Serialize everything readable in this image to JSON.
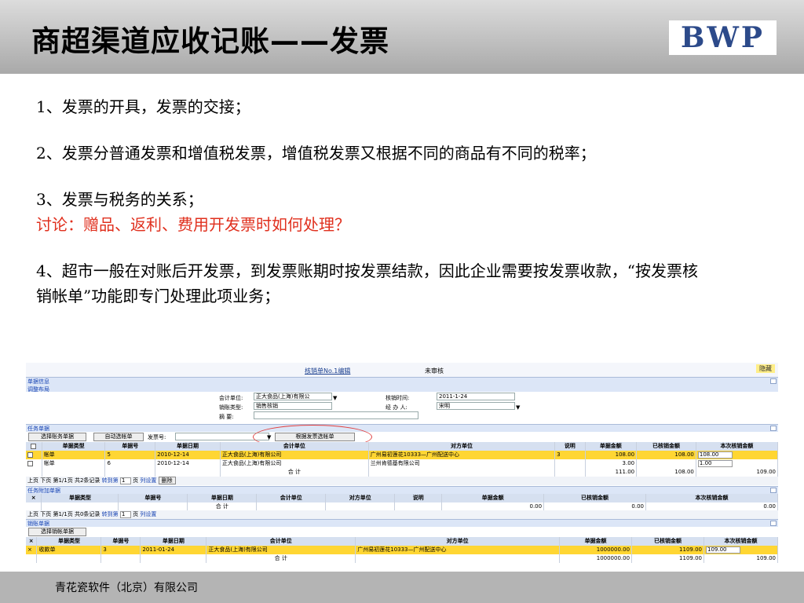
{
  "slide": {
    "title": "商超渠道应收记账——发票",
    "logo": "BWP",
    "points": [
      "1、发票的开具，发票的交接；",
      "2、发票分普通发票和增值税发票，增值税发票又根据不同的商品有不同的税率；",
      "3、发票与税务的关系；",
      "讨论：赠品、返利、费用开发票时如何处理？",
      "4、超市一般在对账后开发票，到发票账期时按发票结款，因此企业需要按发票收款，“按发票核销帐单”功能即专门处理此项业务；"
    ],
    "footer": "青花瓷软件（北京）有限公司"
  },
  "app": {
    "title": "核销单No.1编辑",
    "status": "未审核",
    "hide_label": "隐藏",
    "sections": {
      "info": "单据信息",
      "layout": "调整布局",
      "task": "任务单据",
      "attach": "任务附加单据",
      "sales": "销账单据"
    },
    "form": {
      "account_unit_label": "会计单位:",
      "account_unit_value": "正大食品(上海)有限公",
      "writeoff_time_label": "核销时间:",
      "writeoff_time_value": "2011-1-24",
      "sales_type_label": "销账类型:",
      "sales_type_value": "销售核销",
      "handler_label": "经 办 人:",
      "handler_value": "宋明",
      "summary_label": "摘    要:"
    },
    "task_toolbar": {
      "select_btn": "选择账务单据",
      "auto_btn": "自动选帐单",
      "invoice_label": "发票号:",
      "invoice_btn": "根据发票选帐单"
    },
    "task_headers": [
      "单据类型",
      "单据号",
      "单据日期",
      "会计单位",
      "对方单位",
      "说明",
      "单据金额",
      "已核销金额",
      "本次核销金额"
    ],
    "task_rows": [
      [
        "帐单",
        "5",
        "2010-12-14",
        "正大食品(上海)有限公司",
        "广州易初莲花10333—广州配送中心",
        "3",
        "108.00",
        "108.00",
        "108.00"
      ],
      [
        "帐单",
        "6",
        "2010-12-14",
        "正大食品(上海)有限公司",
        "兰州肯德基有限公司",
        "",
        "3.00",
        "",
        "1.00"
      ]
    ],
    "task_total": [
      "合  计",
      "111.00",
      "108.00",
      "109.00"
    ],
    "pager1": {
      "nav": "上页  下页  第1/1页  共2条记录",
      "goto": "转到第",
      "page": "1",
      "page_unit": "页",
      "col_settings": "列设置",
      "delete": "删除"
    },
    "attach_headers": [
      "单据类型",
      "单据号",
      "单据日期",
      "会计单位",
      "对方单位",
      "说明",
      "单据金额",
      "已核销金额",
      "本次核销金额"
    ],
    "attach_total": [
      "合  计",
      "0.00",
      "0.00",
      "0.00"
    ],
    "pager2": {
      "nav": "上页  下页  第1/1页  共0条记录",
      "goto": "转到第",
      "page": "1",
      "page_unit": "页",
      "col_settings": "列设置"
    },
    "sales_toolbar": {
      "select_btn": "选择销帐单据"
    },
    "sales_headers": [
      "单据类型",
      "单据号",
      "单据日期",
      "会计单位",
      "对方单位",
      "单据金额",
      "已核销金额",
      "本次核销金额"
    ],
    "sales_rows": [
      [
        "收款单",
        "3",
        "2011-01-24",
        "正大食品(上海)有限公司",
        "广州易初莲花10333—广州配送中心",
        "1000000.00",
        "1109.00",
        "109.00"
      ]
    ],
    "sales_total": [
      "合  计",
      "1000000.00",
      "1109.00",
      "109.00"
    ]
  }
}
